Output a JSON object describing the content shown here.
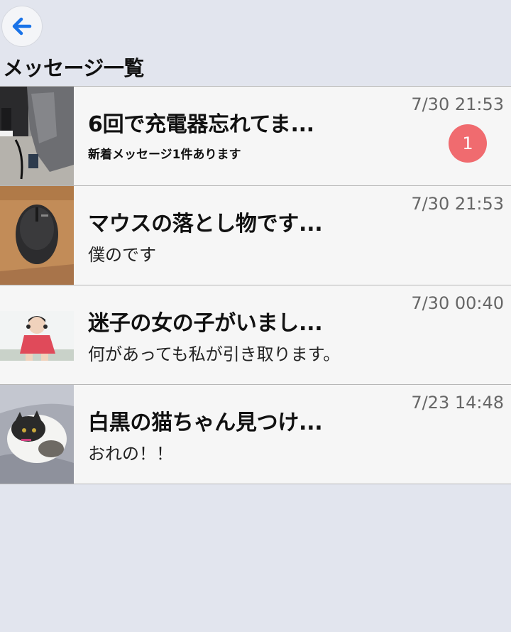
{
  "header": {
    "back_icon": "arrow-left-icon",
    "title": "メッセージ一覧"
  },
  "colors": {
    "background": "#e2e5ee",
    "row_background": "#f6f6f6",
    "back_arrow": "#1a73e8",
    "badge": "#f06b6f"
  },
  "messages": [
    {
      "title": "6回で充電器忘れてま...",
      "preview": "新着メッセージ1件あります",
      "time": "7/30 21:53",
      "unread": "1"
    },
    {
      "title": "マウスの落とし物です...",
      "preview": "僕のです",
      "time": "7/30 21:53"
    },
    {
      "title": "迷子の女の子がいまし...",
      "preview": "何があっても私が引き取ります。",
      "time": "7/30 00:40"
    },
    {
      "title": "白黒の猫ちゃん見つけ...",
      "preview": "おれの！！",
      "time": "7/23 14:48"
    }
  ]
}
